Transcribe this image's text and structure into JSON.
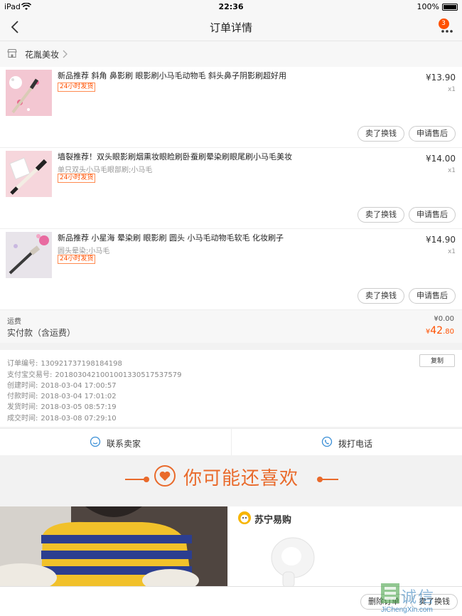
{
  "status_bar": {
    "carrier": "iPad",
    "time": "22:36",
    "battery": "100%"
  },
  "nav": {
    "title": "订单详情",
    "badge": "3"
  },
  "shop": {
    "name": "花胤美妆"
  },
  "items": [
    {
      "name": "新品推荐 斜角 鼻影刷 眼影刷小马毛动物毛 斜头鼻子阴影刷超好用",
      "spec": "",
      "tag": "24小时发货",
      "price": "¥13.90",
      "qty": "x1",
      "exchange": "卖了换钱",
      "service": "申请售后"
    },
    {
      "name": "墙裂推荐！双头眼影刷烟熏妆眼睑刷卧蚕刷晕染刷眼尾刷小马毛美妆",
      "spec": "单只双头小马毛眼部刷;小马毛",
      "tag": "24小时发货",
      "price": "¥14.00",
      "qty": "x1",
      "exchange": "卖了换钱",
      "service": "申请售后"
    },
    {
      "name": "新品推荐 小星海 晕染刷 眼影刷 圆头 小马毛动物毛软毛 化妆刷子",
      "spec": "圆头晕染;小马毛",
      "tag": "24小时发货",
      "price": "¥14.90",
      "qty": "x1",
      "exchange": "卖了换钱",
      "service": "申请售后"
    }
  ],
  "summary": {
    "shipping_label": "运费",
    "shipping_value": "¥0.00",
    "paid_label": "实付款（含运费）",
    "paid_currency": "¥",
    "paid_int": "42",
    "paid_dec": ".80"
  },
  "order_info": {
    "copy": "复制",
    "rows": [
      {
        "label": "订单编号:",
        "value": "130921737198184198"
      },
      {
        "label": "支付宝交易号:",
        "value": "2018030421001001330517537579"
      },
      {
        "label": "创建时间:",
        "value": "2018-03-04 17:00:57"
      },
      {
        "label": "付款时间:",
        "value": "2018-03-04 17:01:02"
      },
      {
        "label": "发货时间:",
        "value": "2018-03-05 08:57:19"
      },
      {
        "label": "成交时间:",
        "value": "2018-03-08 07:29:10"
      }
    ]
  },
  "contact": {
    "seller": "联系卖家",
    "phone": "拨打电话"
  },
  "recommend": {
    "title": "你可能还喜欢"
  },
  "card_right": {
    "brand": "苏宁易购"
  },
  "bottom": {
    "delete": "删除订单",
    "sell": "卖了换钱"
  },
  "watermark": {
    "text": "诚信",
    "url": "JiChengXin.com"
  },
  "colors": {
    "accent": "#ff5000",
    "recommend": "#e96a2b"
  }
}
